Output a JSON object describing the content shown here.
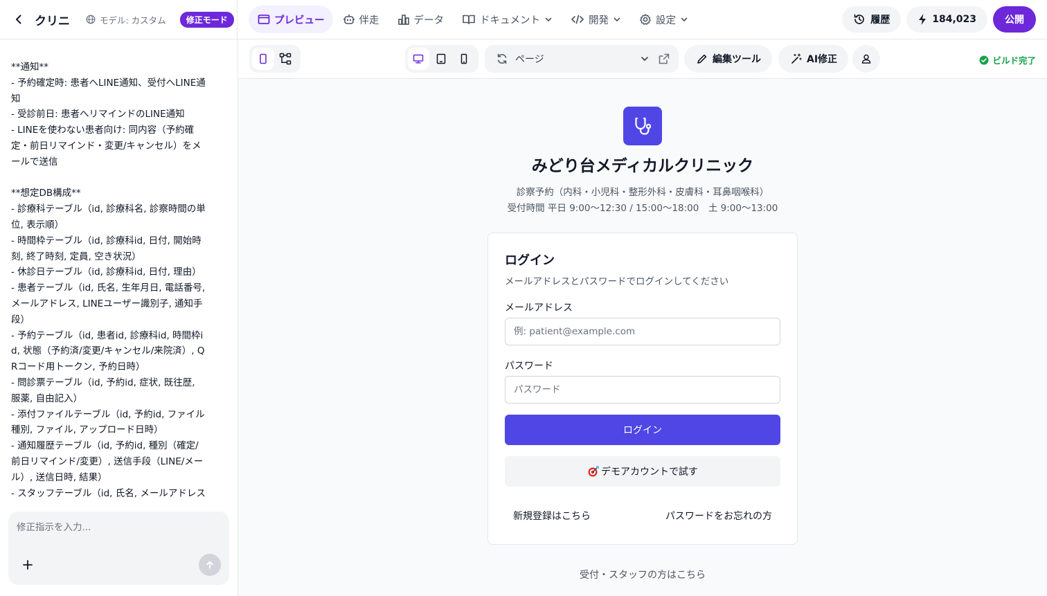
{
  "header": {
    "project_title": "クリニック予約システム",
    "model_label": "モデル: カスタム",
    "mode_badge": "修正モード",
    "nav": [
      {
        "label": "プレビュー",
        "icon": "preview-icon"
      },
      {
        "label": "伴走",
        "icon": "robot-icon"
      },
      {
        "label": "データ",
        "icon": "chart-icon"
      },
      {
        "label": "ドキュメント",
        "icon": "book-icon"
      },
      {
        "label": "開発",
        "icon": "code-icon"
      },
      {
        "label": "設定",
        "icon": "gear-icon"
      }
    ],
    "history_label": "履歴",
    "credits": "184,023",
    "publish_label": "公開"
  },
  "chat": {
    "lines": [
      "**通知**",
      "- 予約確定時: 患者へLINE通知、受付へLINE通知",
      "- 受診前日: 患者へリマインドのLINE通知",
      "- LINEを使わない患者向け: 同内容（予約確定・前日リマインド・変更/キャンセル）をメールで送信",
      "",
      "**想定DB構成**",
      "- 診療科テーブル（id, 診療科名, 診察時間の単位, 表示順）",
      "- 時間枠テーブル（id, 診療科id, 日付, 開始時刻, 終了時刻, 定員, 空き状況）",
      "- 休診日テーブル（id, 診療科id, 日付, 理由）",
      "- 患者テーブル（id, 氏名, 生年月日, 電話番号, メールアドレス, LINEユーザー識別子, 通知手段）",
      "- 予約テーブル（id, 患者id, 診療科id, 時間枠id, 状態（予約済/変更/キャンセル/来院済）, QRコード用トークン, 予約日時）",
      "- 問診票テーブル（id, 予約id, 症状, 既往歴, 服薬, 自由記入）",
      "- 添付ファイルテーブル（id, 予約id, ファイル種別, ファイル, アップロード日時）",
      "- 通知履歴テーブル（id, 予約id, 種別（確定/前日リマインド/変更）, 送信手段（LINE/メール）, 送信日時, 結果）",
      "- スタッフテーブル（id, 氏名, メールアドレス"
    ],
    "input_placeholder": "修正指示を入力..."
  },
  "toolbar": {
    "page_label": "ページ",
    "edit_tool_label": "編集ツール",
    "ai_fix_label": "AI修正",
    "build_status": "ビルド完了"
  },
  "preview": {
    "clinic_name": "みどり台メディカルクリニック",
    "subtitle_line1": "診察予約（内科・小児科・整形外科・皮膚科・耳鼻咽喉科）",
    "subtitle_line2": "受付時間 平日 9:00〜12:30 / 15:00〜18:00　土 9:00〜13:00",
    "login": {
      "title": "ログイン",
      "description": "メールアドレスとパスワードでログインしてください",
      "email_label": "メールアドレス",
      "email_placeholder": "例: patient@example.com",
      "password_label": "パスワード",
      "password_placeholder": "パスワード",
      "submit_label": "ログイン",
      "demo_label": "デモアカウントで試す",
      "register_link": "新規登録はこちら",
      "forgot_link": "パスワードをお忘れの方"
    },
    "staff_link": "受付・スタッフの方はこちら"
  },
  "colors": {
    "brand_purple": "#6d28d9",
    "primary_button": "#4f46e5",
    "success": "#16a34a"
  }
}
